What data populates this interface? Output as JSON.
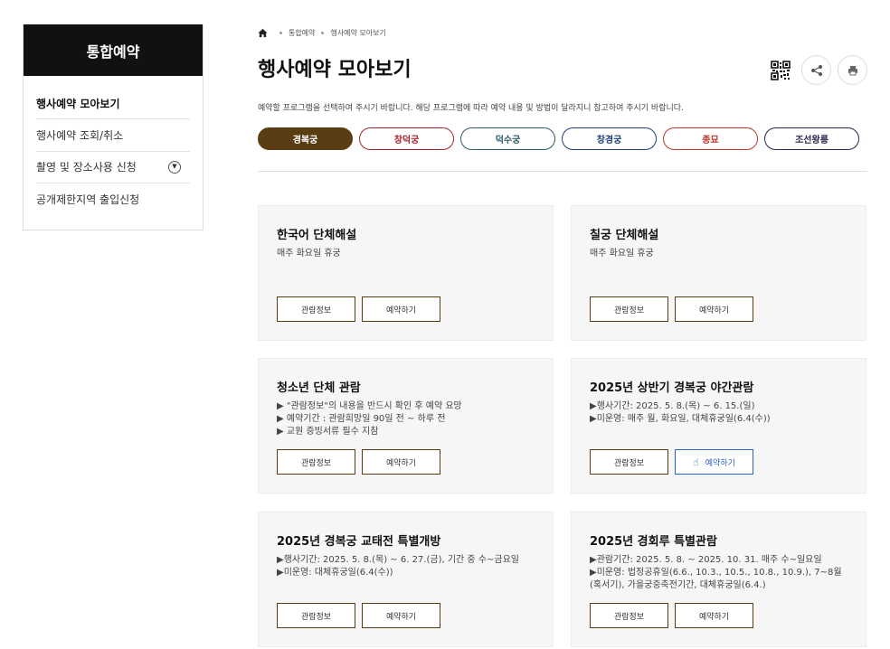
{
  "sidebar": {
    "title": "통합예약",
    "items": [
      {
        "label": "행사예약 모아보기"
      },
      {
        "label": "행사예약 조회/취소"
      },
      {
        "label": "촬영 및 장소사용 신청"
      },
      {
        "label": "공개제한지역 출입신청"
      }
    ]
  },
  "breadcrumb": {
    "items": [
      "통합예약",
      "행사예약 모아보기"
    ]
  },
  "header": {
    "title": "행사예약 모아보기",
    "description": "예약할 프로그램을 선택하여 주시기 바랍니다. 해당 프로그램에 따라 예약 내용 및 방법이 달라지니 참고하여 주시기 바랍니다."
  },
  "tools": {
    "qr_icon": "qr-code-icon",
    "share_icon": "share-icon",
    "print_icon": "print-icon"
  },
  "palaces": [
    {
      "label": "경복궁",
      "color": "#5a3d12",
      "active": true
    },
    {
      "label": "창덕궁",
      "color": "#a8272c"
    },
    {
      "label": "덕수궁",
      "color": "#2b5e6b"
    },
    {
      "label": "창경궁",
      "color": "#1f3f78"
    },
    {
      "label": "종묘",
      "color": "#c0392b"
    },
    {
      "label": "조선왕릉",
      "color": "#2c2450"
    }
  ],
  "cards": [
    {
      "title": "한국어 단체해설",
      "lines": [
        "매주 화요일 휴궁"
      ],
      "info_label": "관람정보",
      "reserve_label": "예약하기"
    },
    {
      "title": "칠궁 단체해설",
      "lines": [
        "매주 화요일 휴궁"
      ],
      "info_label": "관람정보",
      "reserve_label": "예약하기"
    },
    {
      "title": "청소년 단체 관람",
      "lines": [
        "▶ \"관람정보\"의 내용을 반드시 확인 후 예약 요망",
        "▶ 예약기간 : 관람희망일 90일 전 ~ 하루 전",
        "▶ 교원 증빙서류 필수 지참"
      ],
      "info_label": "관람정보",
      "reserve_label": "예약하기"
    },
    {
      "title": "2025년 상반기 경복궁 야간관람",
      "lines": [
        "▶행사기간: 2025. 5. 8.(목) ~ 6. 15.(일)",
        "▶미운영: 매주 월, 화요일, 대체휴궁일(6.4(수))"
      ],
      "info_label": "관람정보",
      "reserve_label": "예약하기",
      "hovered": true
    },
    {
      "title": "2025년 경복궁 교태전 특별개방",
      "lines": [
        "▶행사기간: 2025. 5. 8.(목) ~ 6. 27.(금), 기간 중 수~금요일",
        "▶미운영: 대체휴궁일(6.4(수))"
      ],
      "info_label": "관람정보",
      "reserve_label": "예약하기"
    },
    {
      "title": "2025년 경회루 특별관람",
      "lines": [
        "▶관람기간: 2025. 5. 8. ~ 2025. 10. 31. 매주 수~일요일",
        "▶미운영: 법정공휴일(6.6., 10.3., 10.5., 10.8., 10.9.), 7~8월(혹서기), 가을궁중축전기간, 대체휴궁일(6.4.)"
      ],
      "info_label": "관람정보",
      "reserve_label": "예약하기"
    }
  ]
}
